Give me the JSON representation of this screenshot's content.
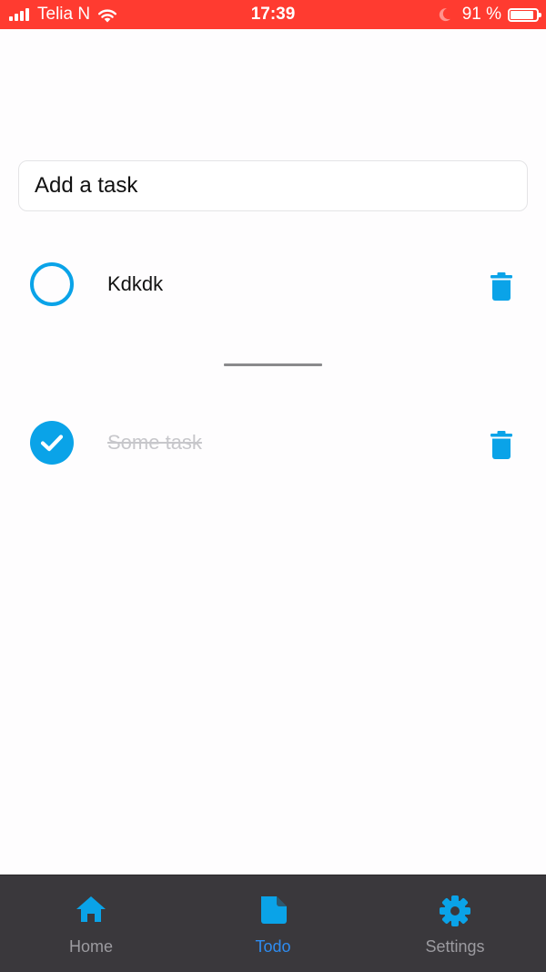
{
  "status_bar": {
    "carrier": "Telia N",
    "time": "17:39",
    "battery_percent": "91 %",
    "battery_level": 0.91,
    "icons": [
      "signal-icon",
      "wifi-icon",
      "moon-icon",
      "battery-icon"
    ]
  },
  "input": {
    "placeholder": "Add a task"
  },
  "tasks": [
    {
      "label": "Kdkdk",
      "completed": false
    },
    {
      "label": "Some task",
      "completed": true
    }
  ],
  "tabs": [
    {
      "label": "Home",
      "icon": "home-icon",
      "active": false
    },
    {
      "label": "Todo",
      "icon": "document-icon",
      "active": true
    },
    {
      "label": "Settings",
      "icon": "gear-icon",
      "active": false
    }
  ],
  "colors": {
    "status_bar": "#ff3b30",
    "accent": "#0aa3e8",
    "tab_active": "#2e8cf0",
    "tab_inactive": "#9c9ba0",
    "tab_bar": "#3a383c",
    "completed_text": "#c7c7cb"
  }
}
